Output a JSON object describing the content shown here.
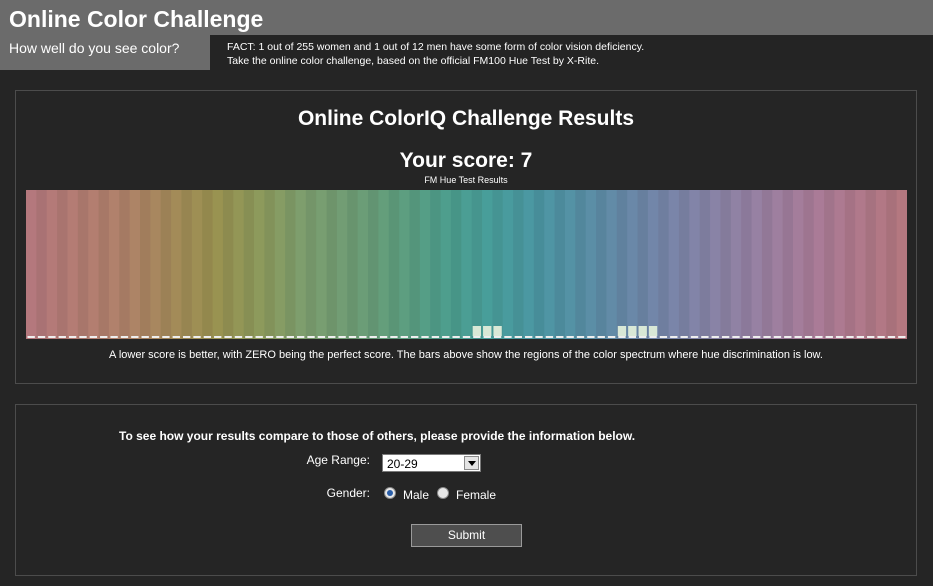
{
  "header": {
    "title": "Online Color Challenge",
    "tagline": "How well do you see color?",
    "fact_line1": "FACT: 1 out of 255 women and 1 out of 12 men have some form of color vision deficiency.",
    "fact_line2": "Take the online color challenge, based on the official FM100 Hue Test by X-Rite."
  },
  "results": {
    "title": "Online ColorIQ Challenge Results",
    "score_label": "Your score: 7",
    "chart_caption": "FM Hue Test Results",
    "note": "A lower score is better, with ZERO being the perfect score. The bars above show the regions of the color spectrum where hue discrimination is low."
  },
  "chart_data": {
    "type": "bar",
    "title": "FM Hue Test Results",
    "cap_count": 85,
    "error_levels": [
      0,
      0,
      0,
      0,
      0,
      0,
      0,
      0,
      0,
      0,
      0,
      0,
      0,
      0,
      0,
      0,
      0,
      0,
      0,
      0,
      0,
      0,
      0,
      0,
      0,
      0,
      0,
      0,
      0,
      0,
      0,
      0,
      0,
      0,
      0,
      0,
      0,
      0,
      0,
      0,
      0,
      0,
      0,
      1,
      1,
      1,
      0,
      0,
      0,
      0,
      0,
      0,
      0,
      0,
      0,
      0,
      0,
      1,
      1,
      1,
      1,
      0,
      0,
      0,
      0,
      0,
      0,
      0,
      0,
      0,
      0,
      0,
      0,
      0,
      0,
      0,
      0,
      0,
      0,
      0,
      0,
      0,
      0,
      0,
      0
    ],
    "spectrum_colors": [
      "#b4787d",
      "#b47c73",
      "#b0826a",
      "#a5895a",
      "#9a9250",
      "#8d9a5c",
      "#7c9e6f",
      "#6f9d75",
      "#5f9e7e",
      "#4e9e8c",
      "#489e9b",
      "#4b97a3",
      "#5790a6",
      "#6888a8",
      "#7a85a9",
      "#8a83a6",
      "#9a80a2",
      "#a87c99",
      "#b0798c",
      "#b47880"
    ],
    "bar_color": "#d9e8d6",
    "baseline_color": "#eeeeee"
  },
  "form": {
    "intro": "To see how your results compare to those of others, please provide the information below.",
    "age_label": "Age Range:",
    "age_value": "20-29",
    "gender_label": "Gender:",
    "male_label": "Male",
    "female_label": "Female",
    "submit_label": "Submit"
  }
}
